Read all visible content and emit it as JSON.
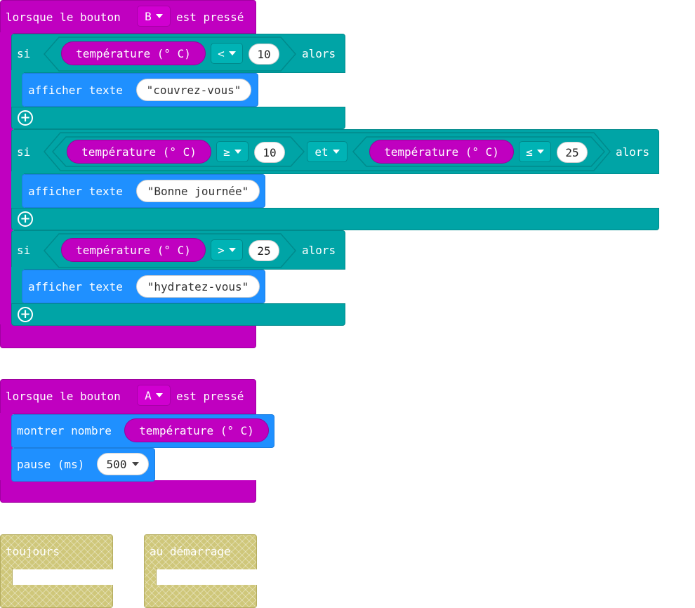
{
  "button_b_event": {
    "prefix": "lorsque le bouton",
    "button": "B",
    "suffix": "est pressé",
    "if1": {
      "keyword": "si",
      "sensor": "température (° C)",
      "operator": "<",
      "value": "10",
      "then": "alors",
      "action": "afficher texte",
      "text": "\"couvrez-vous\""
    },
    "if2": {
      "keyword": "si",
      "sensor_a": "température (° C)",
      "operator_a": "≥",
      "value_a": "10",
      "logic": "et",
      "sensor_b": "température (° C)",
      "operator_b": "≤",
      "value_b": "25",
      "then": "alors",
      "action": "afficher texte",
      "text": "\"Bonne journée\""
    },
    "if3": {
      "keyword": "si",
      "sensor": "température (° C)",
      "operator": ">",
      "value": "25",
      "then": "alors",
      "action": "afficher texte",
      "text": "\"hydratez-vous\""
    }
  },
  "button_a_event": {
    "prefix": "lorsque le bouton",
    "button": "A",
    "suffix": "est pressé",
    "show_number": "montrer nombre",
    "sensor": "température (° C)",
    "pause_label": "pause (ms)",
    "pause_value": "500"
  },
  "disabled_blocks": {
    "forever": "toujours",
    "on_start": "au démarrage"
  },
  "colors": {
    "input": "#c000c0",
    "logic": "#00a4a6",
    "basic": "#1f90ff",
    "disabled": "#cfc77a"
  }
}
